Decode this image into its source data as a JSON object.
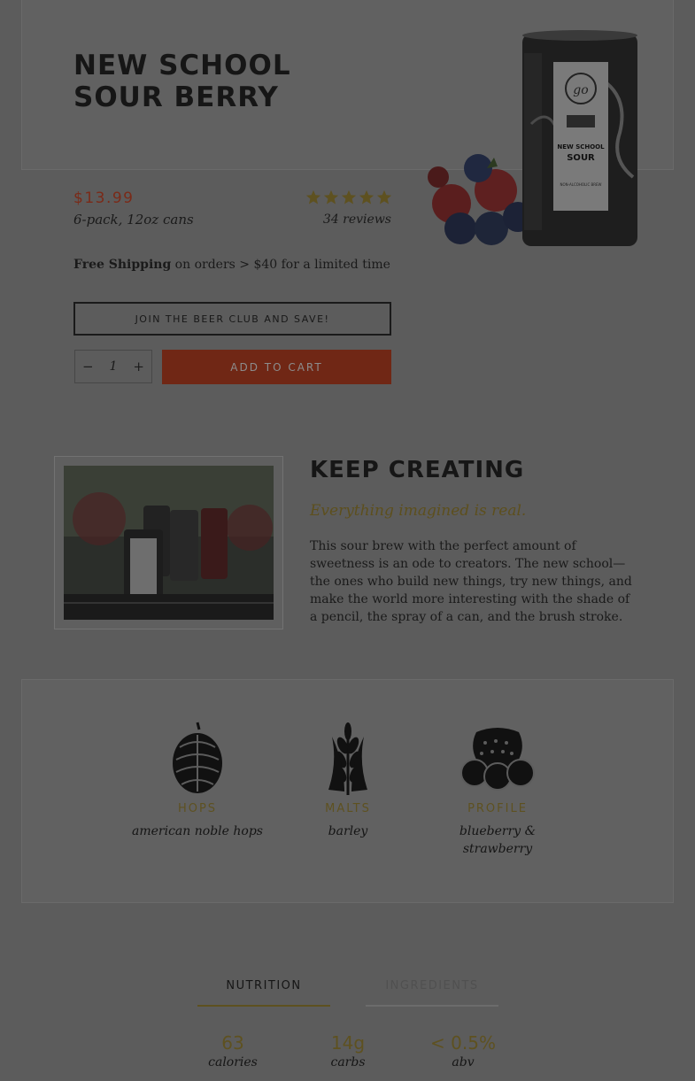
{
  "product": {
    "title_line1": "NEW SCHOOL",
    "title_line2": "SOUR BERRY",
    "price": "$13.99",
    "pack": "6-pack, 12oz cans",
    "rating": 5,
    "reviews": "34 reviews",
    "shipping_bold": "Free Shipping",
    "shipping_rest": " on orders > $40 for a limited time",
    "club_button": "JOIN THE BEER CLUB AND SAVE!",
    "quantity": "1",
    "minus": "−",
    "plus": "+",
    "cart_button": "ADD TO CART"
  },
  "can_label": {
    "brand": "go",
    "line1": "NEW SCHOOL",
    "line2": "SOUR",
    "detail": "NON-ALCOHOLIC BREW"
  },
  "feature": {
    "title": "KEEP CREATING",
    "tagline": "Everything imagined is real.",
    "body": "This sour brew with the perfect amount of sweetness is an ode to creators. The new school—the ones who build new things, try new things, and make the world more interesting with the shade of a pencil, the spray of a can, and the brush stroke."
  },
  "profile": [
    {
      "label": "HOPS",
      "value": "american noble hops",
      "icon": "hop-icon"
    },
    {
      "label": "MALTS",
      "value": "barley",
      "icon": "wheat-icon"
    },
    {
      "label": "PROFILE",
      "value": "blueberry & strawberry",
      "icon": "berries-icon"
    }
  ],
  "tabs": [
    "NUTRITION",
    "INGREDIENTS"
  ],
  "active_tab": "NUTRITION",
  "nutrition": [
    {
      "value": "63",
      "unit": "calories"
    },
    {
      "value": "14g",
      "unit": "carbs"
    },
    {
      "value": "< 0.5%",
      "unit": "abv"
    }
  ],
  "colors": {
    "overlay_bg": "#5c5c5c",
    "accent_red": "#702715",
    "accent_gold": "#5e5120"
  }
}
